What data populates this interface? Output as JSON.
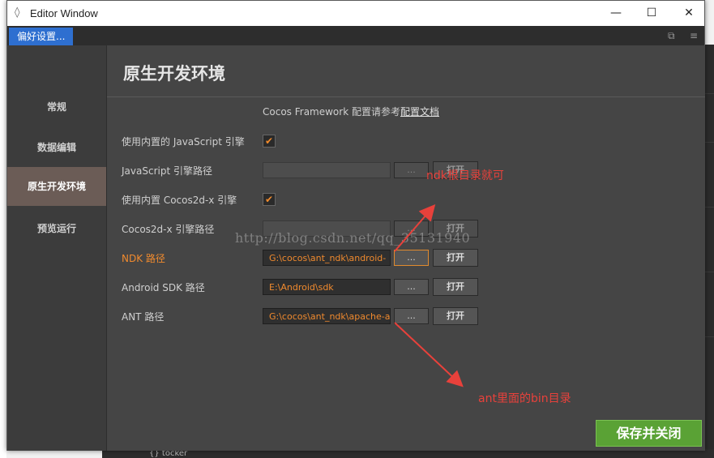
{
  "window": {
    "title": "Editor Window",
    "controls": [
      "—",
      "☐",
      "✕"
    ]
  },
  "tabbar": {
    "tab_label": "偏好设置..."
  },
  "sidebar": {
    "items": [
      {
        "label": "常规"
      },
      {
        "label": "数据编辑"
      },
      {
        "label": "原生开发环境"
      },
      {
        "label": "预览运行"
      }
    ],
    "active_index": 2
  },
  "main": {
    "heading": "原生开发环境",
    "hint_prefix": "Cocos Framework 配置请参考",
    "hint_link": "配置文档",
    "rows": [
      {
        "label": "使用内置的 JavaScript 引擎",
        "checked": true
      },
      {
        "label": "JavaScript 引擎路径",
        "value": "",
        "dots": "...",
        "open": "打开"
      },
      {
        "label": "使用内置 Cocos2d-x 引擎",
        "checked": true
      },
      {
        "label": "Cocos2d-x 引擎路径",
        "value": "",
        "dots": "...",
        "open": "打开"
      },
      {
        "label": "NDK 路径",
        "value": "G:\\cocos\\ant_ndk\\android-",
        "dots": "...",
        "open": "打开"
      },
      {
        "label": "Android SDK 路径",
        "value": "E:\\Android\\sdk",
        "dots": "...",
        "open": "打开"
      },
      {
        "label": "ANT 路径",
        "value": "G:\\cocos\\ant_ndk\\apache-a",
        "dots": "...",
        "open": "打开"
      }
    ],
    "save_button": "保存并关闭"
  },
  "overlay": {
    "watermark": "http://blog.csdn.net/qq_35131940",
    "annotation_ndk": "ndk根目录就可",
    "annotation_ant": "ant里面的bin目录",
    "annotation_color": "#e8413b"
  },
  "background": {
    "bottom_tab": "{} tocker"
  },
  "colors": {
    "accent_orange": "#f08a2e",
    "tab_blue": "#2e6fd0",
    "save_green": "#5aa235",
    "active_nav": "#6b5c56"
  }
}
